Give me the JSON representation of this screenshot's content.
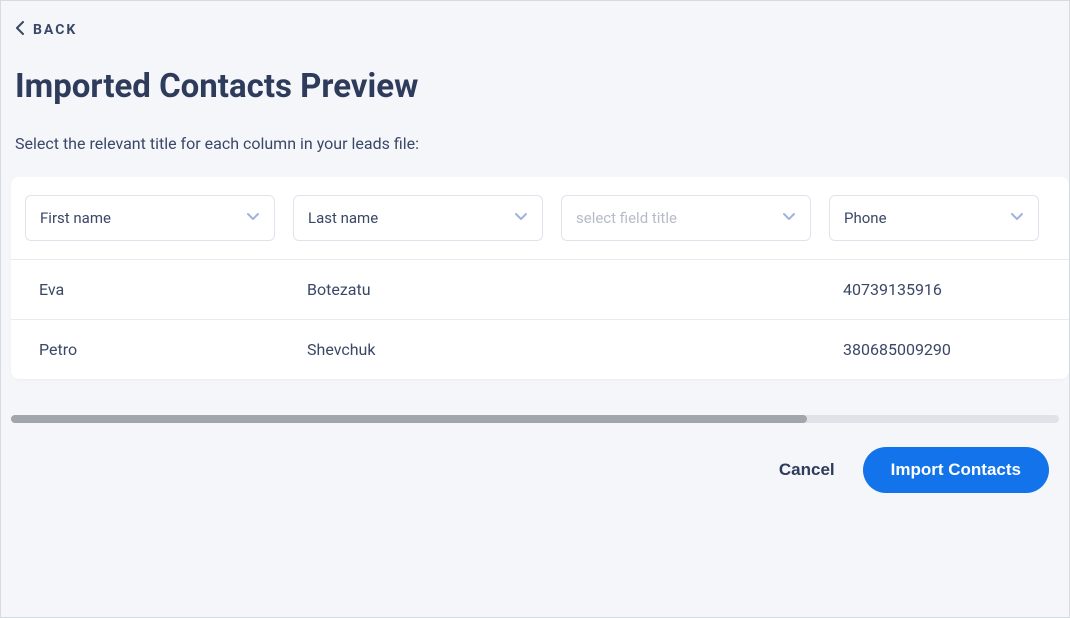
{
  "back_label": "BACK",
  "title": "Imported Contacts Preview",
  "subtitle": "Select the relevant title for each column in your leads file:",
  "columns": [
    {
      "value": "First name",
      "placeholder": "select field title",
      "is_placeholder": false
    },
    {
      "value": "Last name",
      "placeholder": "select field title",
      "is_placeholder": false
    },
    {
      "value": "",
      "placeholder": "select field title",
      "is_placeholder": true
    },
    {
      "value": "Phone",
      "placeholder": "select field title",
      "is_placeholder": false
    }
  ],
  "rows": [
    [
      "Eva",
      "Botezatu",
      "",
      "40739135916"
    ],
    [
      "Petro",
      "Shevchuk",
      "",
      "380685009290"
    ]
  ],
  "footer": {
    "cancel_label": "Cancel",
    "import_label": "Import Contacts"
  }
}
